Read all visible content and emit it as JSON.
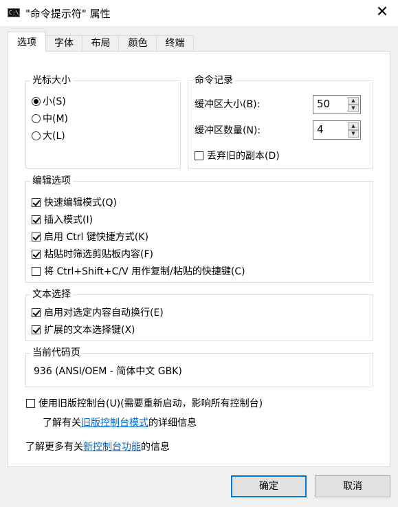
{
  "window": {
    "title": "\"命令提示符\" 属性",
    "icon_text": "C:\\_",
    "close_symbol": "✕"
  },
  "tabs": [
    {
      "label": "选项",
      "active": true
    },
    {
      "label": "字体",
      "active": false
    },
    {
      "label": "布局",
      "active": false
    },
    {
      "label": "颜色",
      "active": false
    },
    {
      "label": "终端",
      "active": false
    }
  ],
  "cursor_size": {
    "title": "光标大小",
    "options": [
      {
        "label": "小(S)",
        "selected": true
      },
      {
        "label": "中(M)",
        "selected": false
      },
      {
        "label": "大(L)",
        "selected": false
      }
    ]
  },
  "command_history": {
    "title": "命令记录",
    "buffer_size_label": "缓冲区大小(B):",
    "buffer_size_value": "50",
    "buffer_count_label": "缓冲区数量(N):",
    "buffer_count_value": "4",
    "discard_label": "丢弃旧的副本(D)",
    "discard_checked": false
  },
  "edit_options": {
    "title": "编辑选项",
    "items": [
      {
        "label": "快速编辑模式(Q)",
        "checked": true
      },
      {
        "label": "插入模式(I)",
        "checked": true
      },
      {
        "label": "启用 Ctrl 键快捷方式(K)",
        "checked": true
      },
      {
        "label": "粘贴时筛选剪贴板内容(F)",
        "checked": true
      },
      {
        "label": "将 Ctrl+Shift+C/V 用作复制/粘贴的快捷键(C)",
        "checked": false
      }
    ]
  },
  "text_selection": {
    "title": "文本选择",
    "items": [
      {
        "label": "启用对选定内容自动换行(E)",
        "checked": true
      },
      {
        "label": "扩展的文本选择键(X)",
        "checked": true
      }
    ]
  },
  "codepage": {
    "title": "当前代码页",
    "value": "936   (ANSI/OEM - 简体中文 GBK)"
  },
  "legacy": {
    "label": "使用旧版控制台(U)(需要重新启动，影响所有控制台)",
    "checked": false,
    "info_prefix": "了解有关",
    "info_link": "旧版控制台模式",
    "info_suffix": "的详细信息"
  },
  "new_features": {
    "prefix": "了解更多有关",
    "link": "新控制台功能",
    "suffix": "的信息"
  },
  "buttons": {
    "ok": "确定",
    "cancel": "取消"
  },
  "colors": {
    "accent": "#0078d7",
    "link": "#0066cc"
  }
}
